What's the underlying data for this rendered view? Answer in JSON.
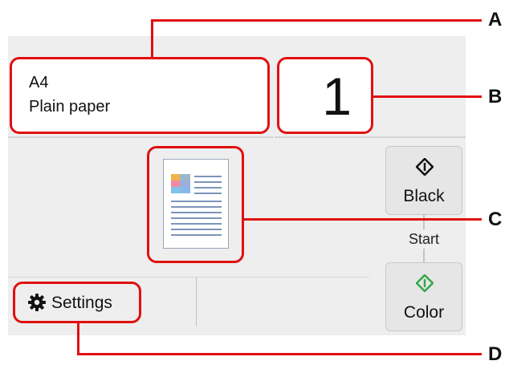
{
  "paper": {
    "size": "A4",
    "type": "Plain paper"
  },
  "copies": {
    "value": "1"
  },
  "buttons": {
    "black_label": "Black",
    "start_label": "Start",
    "color_label": "Color",
    "settings_label": "Settings"
  },
  "callouts": [
    "A",
    "B",
    "C",
    "D"
  ],
  "icons": {
    "start": "start-diamond-icon",
    "settings": "gear-icon",
    "preview": "document-preview-icon"
  },
  "colors": {
    "callout": "#e01010",
    "color_start_icon": "#36a64a",
    "black_start_icon": "#111111",
    "screen_background": "#eeeeee"
  }
}
